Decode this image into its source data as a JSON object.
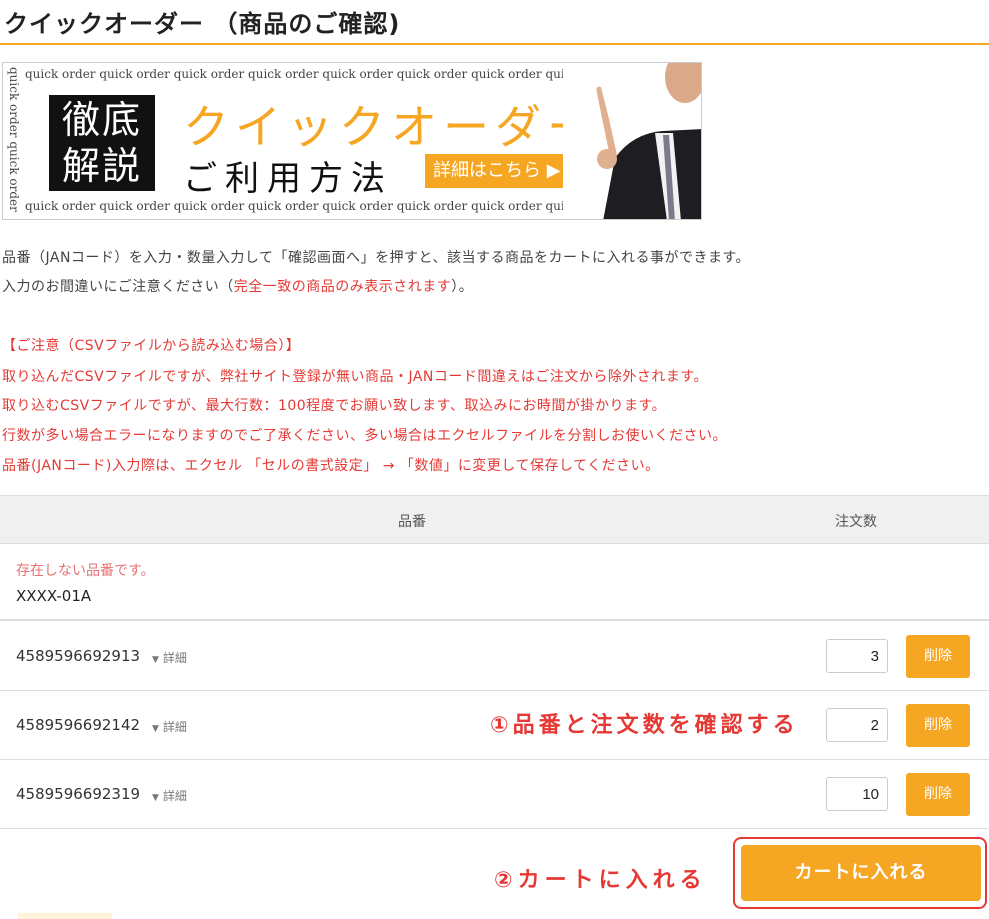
{
  "page": {
    "title": "クイックオーダー （商品のご確認)"
  },
  "banner": {
    "strip_text": "quick order quick order quick order quick order quick order quick order quick order quick order",
    "vertical_text": "quick order quick order",
    "kanji": "徹底解説",
    "main": "クイックオーダー",
    "sub": "ご利用方法",
    "detail_label": "詳細はこちら ▶"
  },
  "instructions": {
    "line1": "品番（JANコード）を入力・数量入力して「確認画面へ」を押すと、該当する商品をカートに入れる事ができます。",
    "line2_prefix": "入力のお間違いにご注意ください（",
    "line2_red": "完全一致の商品のみ表示されます",
    "line2_suffix": "）。"
  },
  "warnings": [
    "【ご注意（CSVファイルから読み込む場合）】",
    "取り込んだCSVファイルですが、弊社サイト登録が無い商品・JANコード間違えはご注文から除外されます。",
    "取り込むCSVファイルですが、最大行数：100程度でお願い致します、取込みにお時間が掛かります。",
    "行数が多い場合エラーになりますのでご了承ください、多い場合はエクセルファイルを分割しお使いください。",
    "品番(JANコード)入力際は、エクセル 「セルの書式設定」 → 「数値」に変更して保存してください。"
  ],
  "table": {
    "col_code": "品番",
    "col_qty": "注文数",
    "error": {
      "message": "存在しない品番です。",
      "code": "XXXX-01A"
    },
    "detail_label": "詳細",
    "delete_label": "削除",
    "rows": [
      {
        "code": "4589596692913",
        "qty": "3"
      },
      {
        "code": "4589596692142",
        "qty": "2"
      },
      {
        "code": "4589596692319",
        "qty": "10"
      }
    ]
  },
  "annotations": {
    "step1": "①品番と注文数を確認する",
    "step2": "②カートに入れる"
  },
  "cart_button": "カートに入れる",
  "colors": {
    "accent": "#f5a623",
    "warning": "#e53935"
  }
}
